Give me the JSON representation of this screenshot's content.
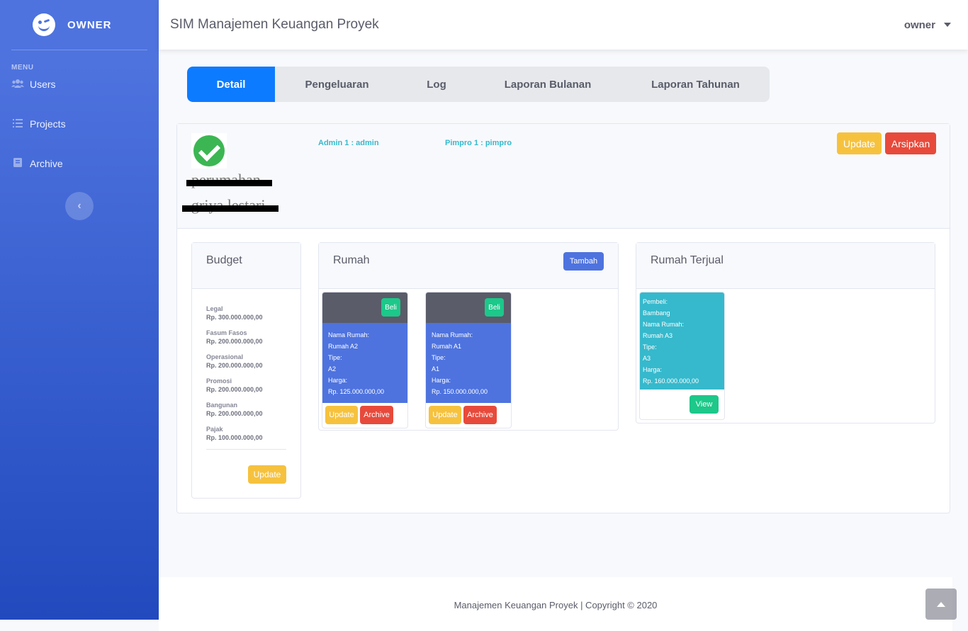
{
  "sidebar": {
    "brand": "OWNER",
    "menu_heading": "MENU",
    "items": [
      {
        "label": "Users",
        "icon": "users-icon"
      },
      {
        "label": "Projects",
        "icon": "list-icon"
      },
      {
        "label": "Archive",
        "icon": "book-icon"
      }
    ],
    "toggle_icon": "‹"
  },
  "topbar": {
    "title": "SIM Manajemen Keuangan Proyek",
    "user": "owner"
  },
  "tabs": [
    "Detail",
    "Pengeluaran",
    "Log",
    "Laporan Bulanan",
    "Laporan Tahunan"
  ],
  "project": {
    "name_line1": "perumahan",
    "name_line2": "griya lestari",
    "admin": "Admin 1 : admin",
    "pimpro": "Pimpro 1 : pimpro",
    "update_label": "Update",
    "archive_label": "Arsipkan"
  },
  "budget": {
    "title": "Budget",
    "items": [
      {
        "label": "Legal",
        "value": "Rp. 300.000.000,00"
      },
      {
        "label": "Fasum Fasos",
        "value": "Rp. 200.000.000,00"
      },
      {
        "label": "Operasional",
        "value": "Rp. 200.000.000,00"
      },
      {
        "label": "Promosi",
        "value": "Rp. 200.000.000,00"
      },
      {
        "label": "Bangunan",
        "value": "Rp. 200.000.000,00"
      },
      {
        "label": "Pajak",
        "value": "Rp. 100.000.000,00"
      }
    ],
    "update_label": "Update"
  },
  "rumah": {
    "title": "Rumah",
    "add_label": "Tambah",
    "houses": [
      {
        "buy": "Beli",
        "lines": [
          "Nama Rumah:",
          "Rumah A2",
          "Tipe:",
          "A2",
          "Harga:",
          "Rp. 125.000.000,00"
        ],
        "update": "Update",
        "archive": "Archive"
      },
      {
        "buy": "Beli",
        "lines": [
          "Nama Rumah:",
          "Rumah A1",
          "Tipe:",
          "A1",
          "Harga:",
          "Rp. 150.000.000,00"
        ],
        "update": "Update",
        "archive": "Archive"
      }
    ]
  },
  "terjual": {
    "title": "Rumah Terjual",
    "items": [
      {
        "lines": [
          "Pembeli:",
          "Bambang",
          "Nama Rumah:",
          "Rumah A3",
          "Tipe:",
          "A3",
          "Harga:",
          "Rp. 160.000.000,00"
        ],
        "view": "View"
      }
    ]
  },
  "footer": {
    "text": "Manajemen Keuangan Proyek | Copyright © 2020"
  }
}
